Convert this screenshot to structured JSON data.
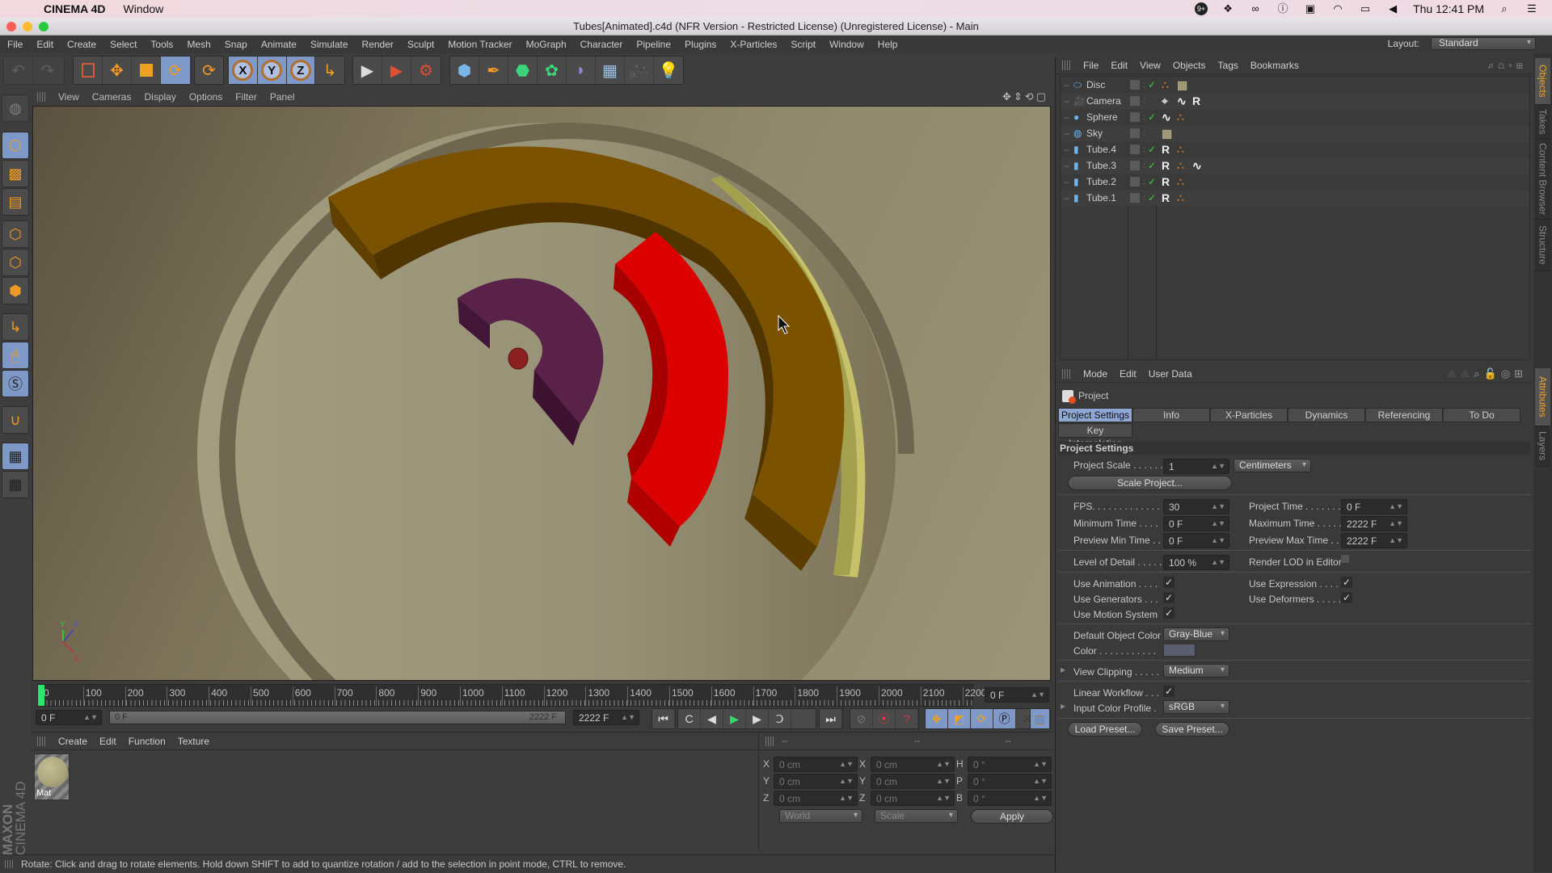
{
  "macos_menubar": {
    "app_name": "CINEMA 4D",
    "menu": "Window",
    "clock": "Thu 12:41 PM",
    "status_icons": [
      "notification-badge-icon",
      "dropbox-icon",
      "creative-cloud-icon",
      "onepassword-icon",
      "screen-record-icon",
      "wifi-icon",
      "airplay-icon",
      "volume-icon",
      "spotlight-icon",
      "notification-center-icon"
    ],
    "badge": "9+"
  },
  "window": {
    "title": "Tubes[Animated].c4d (NFR Version - Restricted License) (Unregistered License) - Main"
  },
  "menubar": {
    "items": [
      "File",
      "Edit",
      "Create",
      "Select",
      "Tools",
      "Mesh",
      "Snap",
      "Animate",
      "Simulate",
      "Render",
      "Sculpt",
      "Motion Tracker",
      "MoGraph",
      "Character",
      "Pipeline",
      "Plugins",
      "X-Particles",
      "Script",
      "Window",
      "Help"
    ],
    "layout_label": "Layout:",
    "layout_value": "Standard"
  },
  "toolbar": {
    "groups": [
      [
        "undo-icon",
        "redo-icon"
      ],
      [
        "live-selection-icon",
        "move-icon",
        "scale-icon",
        "rotate-icon"
      ],
      [
        "recent-tool-icon"
      ],
      [
        "x-axis-lock-icon",
        "y-axis-lock-icon",
        "z-axis-lock-icon",
        "coordinate-system-icon"
      ],
      [
        "render-view-icon",
        "render-picture-viewer-icon",
        "edit-render-settings-icon"
      ],
      [
        "cube-icon",
        "pen-spline-icon",
        "subdivision-surface-icon",
        "array-icon",
        "bend-deformer-icon",
        "floor-icon",
        "camera-icon",
        "light-icon"
      ]
    ],
    "axis_labels": [
      "X",
      "Y",
      "Z"
    ]
  },
  "left_toolbar": {
    "items": [
      "make-editable-icon",
      "model-mode-icon",
      "texture-mode-icon",
      "workplane-mode-icon",
      "points-mode-icon",
      "edges-mode-icon",
      "polygons-mode-icon",
      "axis-mode-icon",
      "tweak-mode-icon",
      "solo-icon",
      "snap-icon",
      "lock-workplane-icon",
      "workplane-icon"
    ]
  },
  "viewport": {
    "menu": [
      "View",
      "Cameras",
      "Display",
      "Options",
      "Filter",
      "Panel"
    ],
    "axis_labels": {
      "x": "X",
      "y": "Y",
      "z": "Z"
    },
    "scene_colors": {
      "disc": "#999378",
      "tube_brown": "#7a5200",
      "tube_red": "#dd0000",
      "tube_purple": "#5a2248",
      "tube_yellow": "#c9c46a",
      "sphere": "#8b2020"
    }
  },
  "timeline": {
    "ticks": [
      "0",
      "100",
      "200",
      "300",
      "400",
      "500",
      "600",
      "700",
      "800",
      "900",
      "1000",
      "1100",
      "1200",
      "1300",
      "1400",
      "1500",
      "1600",
      "1700",
      "1800",
      "1900",
      "2000",
      "2100",
      "2200"
    ],
    "current_frame": "0 F",
    "start_field": "0 F",
    "range_start": "0 F",
    "range_end": "2222 F",
    "end_field": "2222 F",
    "playhead_fraction": 0.0
  },
  "material_manager": {
    "menu": [
      "Create",
      "Edit",
      "Function",
      "Texture"
    ],
    "materials": [
      {
        "name": "Mat",
        "color": "#a9a37c"
      }
    ]
  },
  "coordinates": {
    "headers": [
      "--",
      "--",
      "--"
    ],
    "rows": [
      {
        "pos_label": "X",
        "pos": "0 cm",
        "size_label": "X",
        "size": "0 cm",
        "rot_label": "H",
        "rot": "0 °"
      },
      {
        "pos_label": "Y",
        "pos": "0 cm",
        "size_label": "Y",
        "size": "0 cm",
        "rot_label": "P",
        "rot": "0 °"
      },
      {
        "pos_label": "Z",
        "pos": "0 cm",
        "size_label": "Z",
        "size": "0 cm",
        "rot_label": "B",
        "rot": "0 °"
      }
    ],
    "space": "World",
    "mode": "Scale",
    "apply_label": "Apply"
  },
  "status_bar": {
    "text": "Rotate: Click and drag to rotate elements. Hold down SHIFT to add to quantize rotation / add to the selection in point mode, CTRL to remove."
  },
  "brand": {
    "line1": "MAXON",
    "line2": "CINEMA 4D"
  },
  "object_manager": {
    "menu": [
      "File",
      "Edit",
      "View",
      "Objects",
      "Tags",
      "Bookmarks"
    ],
    "objects": [
      {
        "name": "Disc",
        "icon": "disc-icon",
        "enabled": true,
        "tags": [
          "phong-tag-icon",
          "material-tag-icon"
        ]
      },
      {
        "name": "Camera",
        "icon": "camera-icon",
        "enabled": false,
        "tags": [
          "target-tag-icon",
          "spline-tag-icon",
          "r-tag-icon"
        ]
      },
      {
        "name": "Sphere",
        "icon": "sphere-icon",
        "enabled": true,
        "tags": [
          "spline-tag-icon",
          "phong-tag-icon"
        ]
      },
      {
        "name": "Sky",
        "icon": "sky-icon",
        "enabled": false,
        "tags": [
          "material-tag-icon"
        ]
      },
      {
        "name": "Tube.4",
        "icon": "tube-icon",
        "enabled": true,
        "tags": [
          "r-tag-icon",
          "phong-tag-icon"
        ]
      },
      {
        "name": "Tube.3",
        "icon": "tube-icon",
        "enabled": true,
        "tags": [
          "r-tag-icon",
          "phong-tag-icon",
          "spline-tag-icon"
        ]
      },
      {
        "name": "Tube.2",
        "icon": "tube-icon",
        "enabled": true,
        "tags": [
          "r-tag-icon",
          "phong-tag-icon"
        ]
      },
      {
        "name": "Tube.1",
        "icon": "tube-icon",
        "enabled": true,
        "tags": [
          "r-tag-icon",
          "phong-tag-icon"
        ]
      }
    ]
  },
  "side_tabs": {
    "top": [
      "Objects",
      "Takes",
      "Content Browser",
      "Structure"
    ],
    "bottom": [
      "Attributes",
      "Layers"
    ]
  },
  "attributes": {
    "menu": [
      "Mode",
      "Edit",
      "User Data"
    ],
    "header": "Project",
    "tabs": [
      "Project Settings",
      "Info",
      "X-Particles",
      "Dynamics",
      "Referencing",
      "To Do"
    ],
    "tab2": "Key Interpolation",
    "active_tab": "Project Settings",
    "section": "Project Settings",
    "project_scale_label": "Project Scale . . . . . .",
    "project_scale": "1",
    "project_scale_unit": "Centimeters",
    "scale_project_button": "Scale Project...",
    "fps_label": "FPS. . . . . . . . . . . . .",
    "fps": "30",
    "project_time_label": "Project Time . . . . . . .",
    "project_time": "0 F",
    "min_time_label": "Minimum Time . . . .",
    "min_time": "0 F",
    "max_time_label": "Maximum Time . . . . .",
    "max_time": "2222 F",
    "preview_min_label": "Preview Min Time . .",
    "preview_min": "0 F",
    "preview_max_label": "Preview Max Time . .",
    "preview_max": "2222 F",
    "lod_label": "Level of Detail . . . . .",
    "lod": "100 %",
    "render_lod_label": "Render LOD in Editor",
    "render_lod": false,
    "use_animation_label": "Use Animation . . . .",
    "use_animation": true,
    "use_expression_label": "Use Expression . . . . .",
    "use_expression": true,
    "use_generators_label": "Use Generators . . .",
    "use_generators": true,
    "use_deformers_label": "Use Deformers . . . . .",
    "use_deformers": true,
    "use_motion_label": "Use Motion System",
    "use_motion": true,
    "default_color_label": "Default Object Color",
    "default_color": "Gray-Blue",
    "color_label": "Color . . . . . . . . . . .",
    "color_swatch": "#5a5e6e",
    "view_clipping_label": "View Clipping . . . . .",
    "view_clipping": "Medium",
    "linear_workflow_label": "Linear Workflow . . .",
    "linear_workflow": true,
    "input_profile_label": "Input Color Profile .",
    "input_profile": "sRGB",
    "load_preset": "Load Preset...",
    "save_preset": "Save Preset..."
  }
}
